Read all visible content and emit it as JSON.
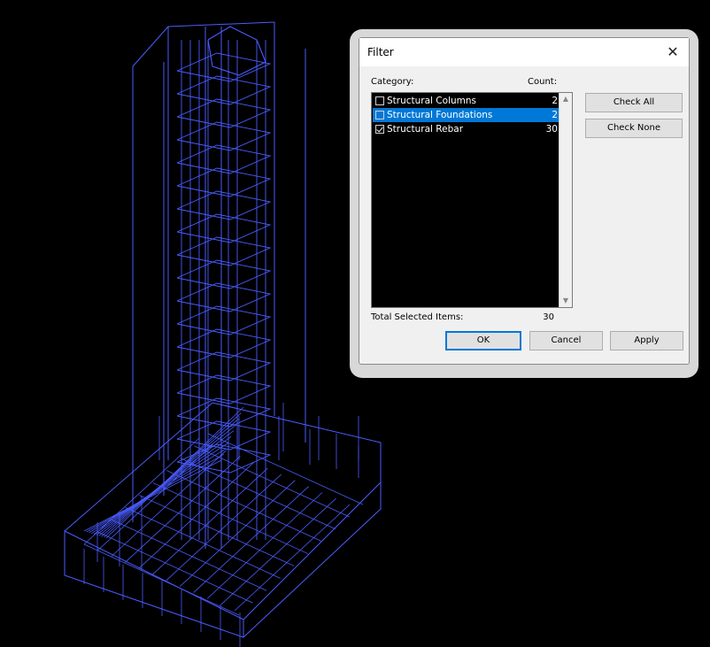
{
  "dialog": {
    "title": "Filter",
    "close_glyph": "✕",
    "column_category": "Category:",
    "column_count": "Count:",
    "items": [
      {
        "label": "Structural Columns",
        "count": "2",
        "checked": false,
        "selected": false
      },
      {
        "label": "Structural Foundations",
        "count": "2",
        "checked": false,
        "selected": true
      },
      {
        "label": "Structural Rebar",
        "count": "30",
        "checked": true,
        "selected": false
      }
    ],
    "check_all_label": "Check All",
    "check_none_label": "Check None",
    "total_label": "Total Selected Items:",
    "total_value": "30",
    "ok_label": "OK",
    "cancel_label": "Cancel",
    "apply_label": "Apply"
  },
  "colors": {
    "wireframe": "#4a5cff",
    "selection": "#0078d7",
    "list_background": "#000000",
    "canvas_background": "#000000"
  },
  "icons": {
    "close": "close-icon",
    "scroll_up": "scroll-up-icon",
    "scroll_down": "scroll-down-icon",
    "checkbox": "checkbox-icon"
  }
}
